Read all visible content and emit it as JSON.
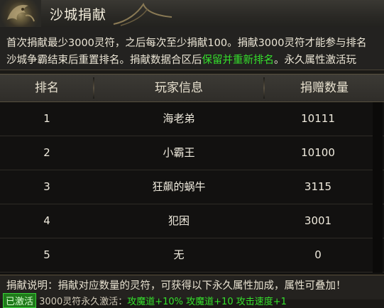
{
  "window": {
    "title": "沙城捐献"
  },
  "description": {
    "line1": "首次捐献最少3000灵符，之后每次至少捐献100。捐献3000灵符才能参与排名",
    "line2_prefix": "沙城争霸结束后重置排名。捐献数据合区后",
    "line2_highlight": "保留并重新排名",
    "line2_suffix": "。永久属性激活玩"
  },
  "table": {
    "headers": [
      "排名",
      "玩家信息",
      "捐赠数量"
    ],
    "rows": [
      {
        "rank": "1",
        "name": "海老弟",
        "amount": "10111"
      },
      {
        "rank": "2",
        "name": "小霸王",
        "amount": "10100"
      },
      {
        "rank": "3",
        "name": "狂飙的蜗牛",
        "amount": "3115"
      },
      {
        "rank": "4",
        "name": "犯困",
        "amount": "3001"
      },
      {
        "rank": "5",
        "name": "无",
        "amount": "0"
      }
    ]
  },
  "footer": {
    "note": "捐献说明：捐献对应数量的灵符，可获得以下永久属性加成，属性可叠加！",
    "badge": "已激活",
    "line2_text": "3000灵符永久激活：",
    "line2_bonus": "攻魔道+10% 攻魔道+10 攻击速度+1"
  },
  "colors": {
    "highlight_green": "#35e02c",
    "header_bg": "#2a2925",
    "table_bg": "#121110"
  },
  "icons": {
    "emblem": "dragon-emblem-icon"
  }
}
